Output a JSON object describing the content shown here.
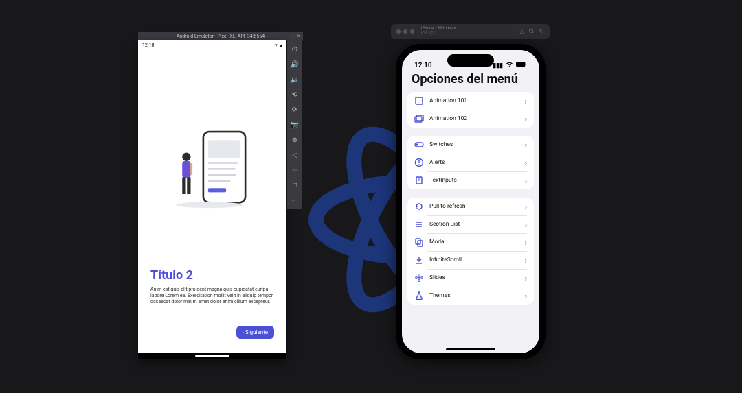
{
  "android": {
    "emulator_title": "Android Emulator - Pixel_XL_API_34:5554",
    "status_time": "12:10",
    "slide": {
      "title": "Título 2",
      "desc": "Anim est quis elit proident magna quis cupidatat curlpa labore Lorem ea. Exercitation mollit velit in aliquip tempor occaecat dolor minim amet dolor enim cillum excepteur.",
      "next_label": "Siguiente"
    },
    "win_min": "−",
    "win_close": "×",
    "side_tools": {
      "power": "⏻",
      "vol_up": "🔊",
      "vol_down": "🔉",
      "rotate_l": "⟲",
      "rotate_r": "⟳",
      "camera": "📷",
      "zoom": "⊕",
      "back": "◁",
      "home": "○",
      "overview": "□",
      "more": "⋯"
    }
  },
  "iphone": {
    "header_device": "iPhone 15 Pro Max",
    "header_os": "iOS 17.2",
    "status_time": "12:10",
    "page_title": "Opciones del menú",
    "groups": [
      {
        "items": [
          {
            "icon": "cube",
            "label": "Animation 101"
          },
          {
            "icon": "albums",
            "label": "Animation 102"
          }
        ]
      },
      {
        "items": [
          {
            "icon": "toggle",
            "label": "Switches"
          },
          {
            "icon": "alert",
            "label": "Alerts"
          },
          {
            "icon": "doc",
            "label": "TextInputs"
          }
        ]
      },
      {
        "items": [
          {
            "icon": "refresh",
            "label": "Pull to refresh"
          },
          {
            "icon": "list",
            "label": "Section List"
          },
          {
            "icon": "copy",
            "label": "Modal"
          },
          {
            "icon": "download",
            "label": "InfiniteScroll"
          },
          {
            "icon": "flower",
            "label": "Slides"
          },
          {
            "icon": "flask",
            "label": "Themes"
          }
        ]
      }
    ]
  }
}
